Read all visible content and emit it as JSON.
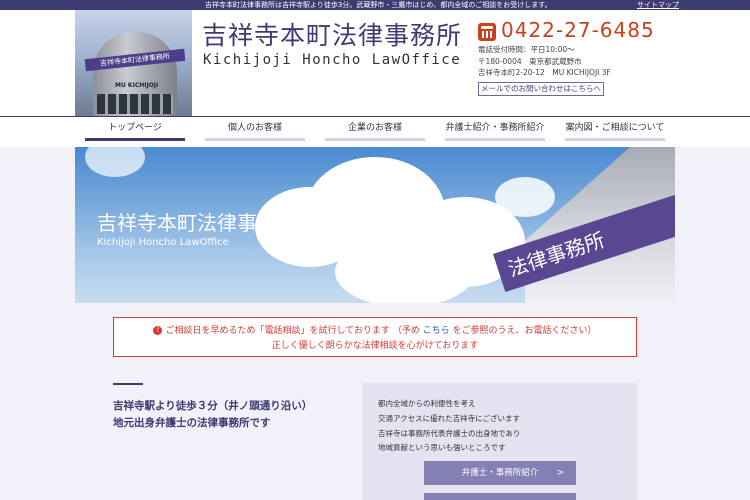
{
  "top_bar": {
    "notice": "吉祥寺本町法律事務所は吉祥寺駅より徒歩3分。武蔵野市・三鷹市はじめ、都内全域のご相談をお受けします。",
    "sitemap": "サイトマップ"
  },
  "header": {
    "photo_band_text": "吉祥寺本町法律事務所",
    "photo_sign_text": "MU KICHIJOJI",
    "title_jp": "吉祥寺本町法律事務所",
    "title_en": "Kichijoji Honcho LawOffice",
    "phone": "0422-27-6485",
    "hours": "電話受付時間：平日10:00～",
    "postal": "〒180-0004　東京都武蔵野市",
    "address": "吉祥寺本町2-20-12　MU KICHIJOJI 3F",
    "mail_button": "メールでのお問い合わせはこちらへ"
  },
  "nav": {
    "items": [
      {
        "label": "トップページ",
        "active": true
      },
      {
        "label": "個人のお客様"
      },
      {
        "label": "企業のお客様"
      },
      {
        "label": "弁護士紹介・事務所紹介"
      },
      {
        "label": "案内図・ご相談について"
      }
    ]
  },
  "hero": {
    "title": "吉祥寺本町法律事務所",
    "subtitle": "Kichijoji Honcho LawOffice",
    "band_text": "法律事務所"
  },
  "alert": {
    "icon": "!",
    "text_before": "ご相談日を早めるため「電話相談」を試行しております （予め ",
    "link": "こちら",
    "text_after": " をご参照のうえ、お電話ください）",
    "line2": "正しく優しく朗らかな法律相談を心がけております"
  },
  "lead": {
    "line1": "吉祥寺駅より徒歩３分（井ノ頭通り沿い）",
    "line2": "地元出身弁護士の法律事務所です"
  },
  "side": {
    "lines": [
      "都内全域からの利便性を考え",
      "交通アクセスに優れた吉祥寺にございます",
      "吉祥寺は事務所代表弁護士の出身地であり",
      "地域貢献という思いも強いところです"
    ],
    "button": "弁護士・事務所紹介",
    "chevron": ">"
  },
  "colors": {
    "brand": "#3e3a72",
    "phone": "#c8401e",
    "alert": "#d63a3a",
    "button": "#8581b5"
  }
}
